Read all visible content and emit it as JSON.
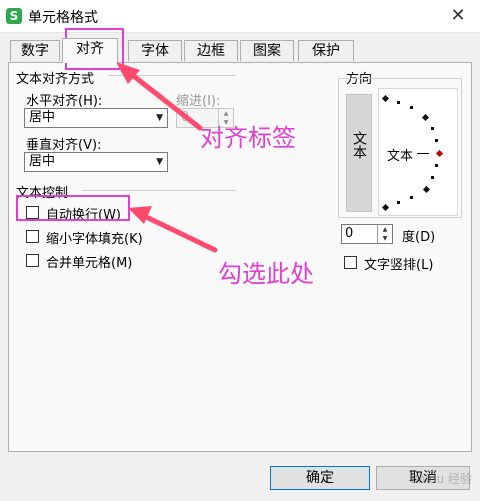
{
  "window": {
    "title": "单元格格式",
    "app_icon_glyph": "S",
    "close_glyph": "✕"
  },
  "tabs": [
    {
      "label": "数字",
      "active": false
    },
    {
      "label": "对齐",
      "active": true
    },
    {
      "label": "字体",
      "active": false
    },
    {
      "label": "边框",
      "active": false
    },
    {
      "label": "图案",
      "active": false
    },
    {
      "label": "保护",
      "active": false
    }
  ],
  "text_alignment": {
    "group_title": "文本对齐方式",
    "horizontal_label": "水平对齐(H):",
    "horizontal_value": "居中",
    "indent_label": "缩进(I):",
    "indent_value": "0",
    "vertical_label": "垂直对齐(V):",
    "vertical_value": "居中"
  },
  "text_control": {
    "group_title": "文本控制",
    "wrap_text": {
      "label": "自动换行(W)",
      "checked": false
    },
    "shrink_to_fit": {
      "label": "缩小字体填充(K)",
      "checked": false
    },
    "merge_cells": {
      "label": "合并单元格(M)",
      "checked": false
    }
  },
  "orientation": {
    "group_title": "方向",
    "vertical_text": "文本",
    "dial_text": "文本",
    "degree_value": "0",
    "degree_label": "度(D)",
    "vertical_stack": {
      "label": "文字竖排(L)",
      "checked": false
    }
  },
  "buttons": {
    "ok": "确定",
    "cancel": "取消"
  },
  "annotations": {
    "tab_note": "对齐标签",
    "checkbox_note": "勾选此处",
    "color": "#e040d0"
  },
  "watermark": "Baidu 经验"
}
